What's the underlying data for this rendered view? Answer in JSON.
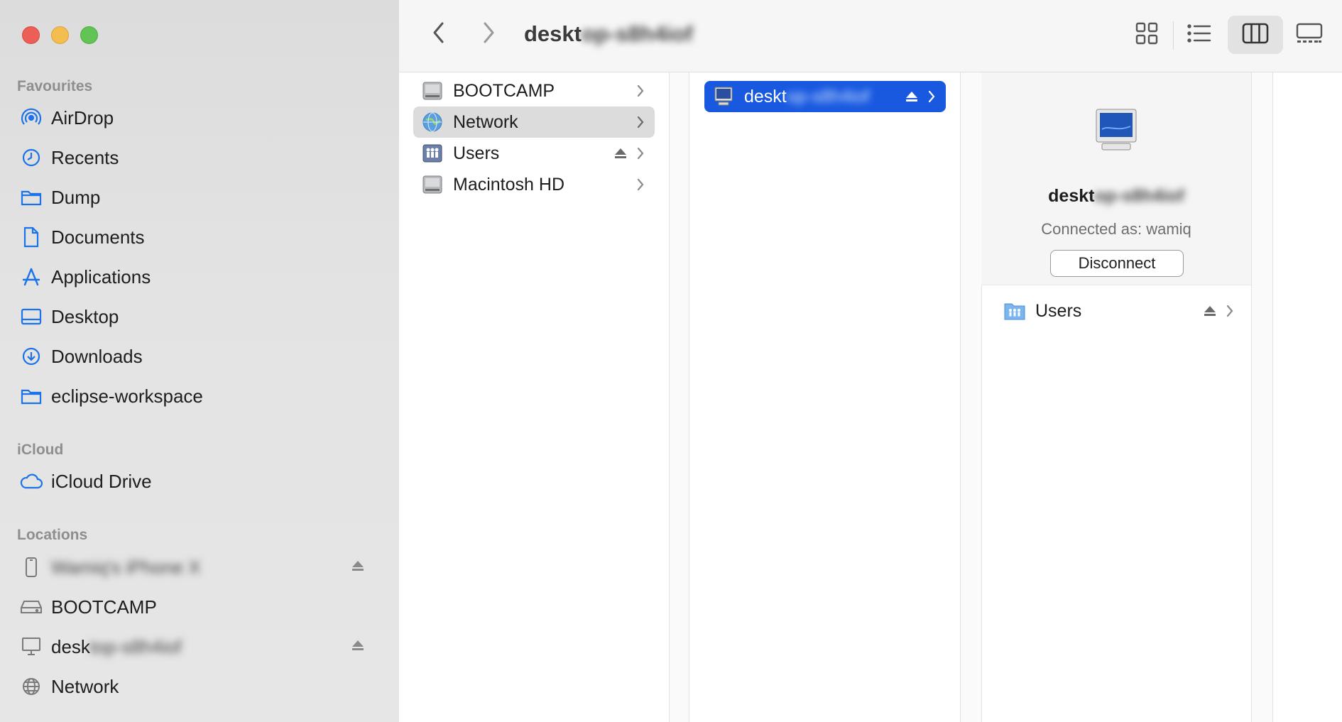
{
  "window": {
    "title_visible": "deskt",
    "title_blurred": "op-s8h4iof"
  },
  "sidebar": {
    "sections": [
      {
        "title": "Favourites",
        "items": [
          {
            "label": "AirDrop",
            "icon": "airdrop-icon"
          },
          {
            "label": "Recents",
            "icon": "clock-icon"
          },
          {
            "label": "Dump",
            "icon": "folder-icon"
          },
          {
            "label": "Documents",
            "icon": "document-icon"
          },
          {
            "label": "Applications",
            "icon": "applications-icon"
          },
          {
            "label": "Desktop",
            "icon": "desktop-icon"
          },
          {
            "label": "Downloads",
            "icon": "download-icon"
          },
          {
            "label": "eclipse-workspace",
            "icon": "folder-icon"
          }
        ]
      },
      {
        "title": "iCloud",
        "items": [
          {
            "label": "iCloud Drive",
            "icon": "cloud-icon"
          }
        ]
      },
      {
        "title": "Locations",
        "items": [
          {
            "label": "Wamiq's iPhone X",
            "icon": "iphone-icon",
            "blurred": true,
            "eject": true
          },
          {
            "label": "BOOTCAMP",
            "icon": "drive-icon"
          },
          {
            "label_visible": "desk",
            "label_blurred": "top-s8h4iof",
            "icon": "computer-icon",
            "eject": true
          },
          {
            "label": "Network",
            "icon": "network-icon"
          }
        ]
      }
    ]
  },
  "toolbar": {
    "view_modes": [
      "icon-view",
      "list-view",
      "column-view",
      "gallery-view"
    ],
    "active_view": "column-view"
  },
  "column1": {
    "items": [
      {
        "label": "BOOTCAMP",
        "icon": "drive-icon"
      },
      {
        "label": "Network",
        "icon": "network-globe-icon",
        "selected": true
      },
      {
        "label": "Users",
        "icon": "shared-users-icon",
        "eject": true
      },
      {
        "label": "Macintosh HD",
        "icon": "drive-icon"
      }
    ]
  },
  "column2": {
    "item": {
      "label_visible": "deskt",
      "label_blurred": "op-s8h4iof",
      "icon": "computer-icon",
      "eject": true,
      "selected": true
    }
  },
  "preview": {
    "name_visible": "deskt",
    "name_blurred": "op-s8h4iof",
    "connected_as": "Connected as: wamiq",
    "disconnect_label": "Disconnect",
    "share": {
      "label": "Users",
      "icon": "users-folder-icon",
      "eject": true
    }
  },
  "colors": {
    "selection_blue": "#1859e0",
    "sidebar_accent": "#1a73e8",
    "traffic_red": "#ec5f57",
    "traffic_yellow": "#f4bd4f",
    "traffic_green": "#61c454"
  }
}
